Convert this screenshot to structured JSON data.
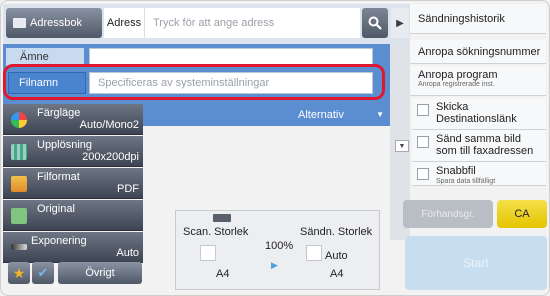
{
  "header": {
    "address_book_label": "Adressbok",
    "address_label": "Adress",
    "address_placeholder": "Tryck för att ange adress"
  },
  "fields": {
    "subject_label": "Ämne",
    "subject_value": "",
    "filename_label": "Filnamn",
    "filename_placeholder": "Specificeras av systeminställningar"
  },
  "options_dropdown": "Alternativ",
  "settings": [
    {
      "label": "Färgläge",
      "value": "Auto/Mono2"
    },
    {
      "label": "Upplösning",
      "value": "200x200dpi"
    },
    {
      "label": "Filformat",
      "value": "PDF"
    },
    {
      "label": "Original",
      "value": ""
    },
    {
      "label": "Exponering",
      "value": "Auto"
    }
  ],
  "bottom_left": {
    "other_label": "Övrigt"
  },
  "preview": {
    "scan_size_label": "Scan. Storlek",
    "send_size_label": "Sändn. Storlek",
    "ratio": "100%",
    "scan_size_value": "A4",
    "send_size_value": "A4",
    "send_size_auto": "Auto"
  },
  "right_panel": {
    "history": "Sändningshistorik",
    "recall_search": "Anropa sökningsnummer",
    "recall_program": "Anropa program",
    "recall_program_sub": "Anropa registrerade inst.",
    "send_link": "Skicka Destinationslänk",
    "send_same_image": "Sänd samma bild som till faxadressen",
    "quick_file": "Snabbfil",
    "quick_file_sub": "Spara data tillfälligt"
  },
  "actions": {
    "preview_button": "Förhandsgr.",
    "ca_label": "CA",
    "start_label": "Start"
  },
  "colors": {
    "blue_panel": "#5b8ed1",
    "highlight": "#e0182f",
    "ca_yellow": "#f4e04a"
  }
}
